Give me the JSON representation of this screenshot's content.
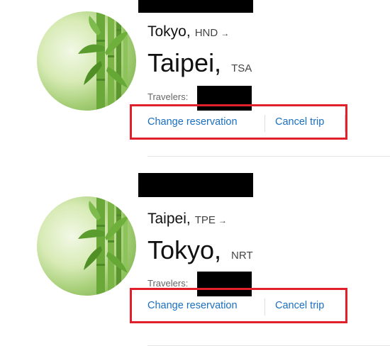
{
  "trips": [
    {
      "origin_city": "Tokyo,",
      "origin_code": "HND",
      "arrow": "→",
      "destination_city": "Taipei,",
      "destination_code": "TSA",
      "travelers_label": "Travelers:",
      "change_label": "Change reservation",
      "cancel_label": "Cancel trip"
    },
    {
      "origin_city": "Taipei,",
      "origin_code": "TPE",
      "arrow": "→",
      "destination_city": "Tokyo,",
      "destination_code": "NRT",
      "travelers_label": "Travelers:",
      "change_label": "Change reservation",
      "cancel_label": "Cancel trip"
    }
  ],
  "colors": {
    "link": "#1a6fc0",
    "highlight_border": "#e0202a",
    "redaction": "#000000"
  },
  "icons": {
    "destination_image": "bamboo-photo",
    "direction": "arrow-right-icon"
  }
}
